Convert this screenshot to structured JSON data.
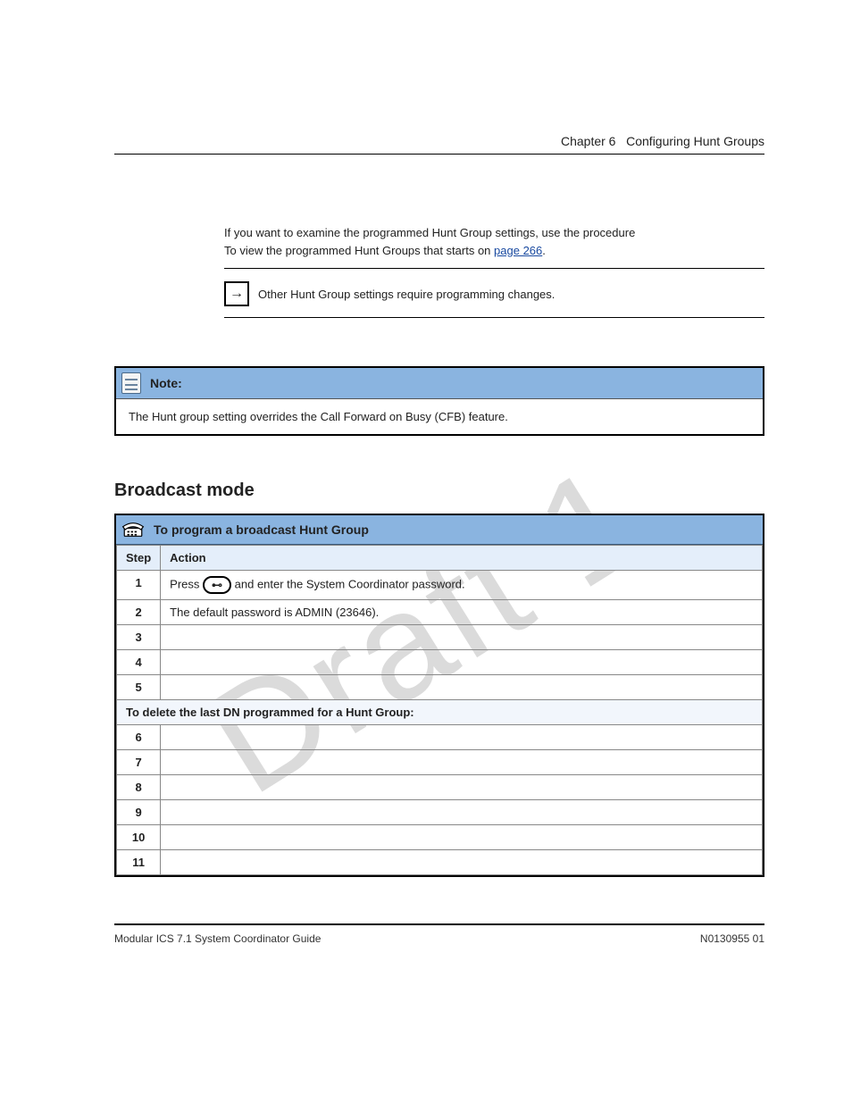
{
  "header": {
    "chapter": "Chapter 6",
    "title": "Configuring Hunt Groups"
  },
  "intro": {
    "line1": "If you want to examine the programmed Hunt Group settings, use the procedure",
    "line2_a": "To view the programmed Hunt Groups that starts on ",
    "line2_link": "page 266",
    "line2_b": "."
  },
  "arrow": {
    "text": "Other Hunt Group settings require programming changes."
  },
  "note_panel": {
    "title": "Note:",
    "body": "The Hunt group setting overrides the Call Forward on Busy (CFB) feature."
  },
  "section_heading": "Broadcast mode",
  "proc_panel": {
    "title": "To program a broadcast Hunt Group",
    "header_row": {
      "step": "Step",
      "action": "Action"
    },
    "rows": [
      {
        "step": "1",
        "prefix": "Press ",
        "key": "⊷",
        "suffix": " and enter the System Coordinator password."
      },
      {
        "step": "2",
        "text": "The default password is ADMIN (23646)."
      },
      {
        "step": "3",
        "text": ""
      },
      {
        "step": "4",
        "text": ""
      },
      {
        "step": "5",
        "text": ""
      }
    ],
    "sub_header": "To delete the last DN programmed for a Hunt Group:",
    "sub_rows": [
      {
        "step": "6",
        "text": ""
      },
      {
        "step": "7",
        "text": ""
      },
      {
        "step": "8",
        "text": ""
      },
      {
        "step": "9",
        "text": ""
      },
      {
        "step": "10",
        "text": ""
      },
      {
        "step": "11",
        "text": ""
      }
    ]
  },
  "footer": {
    "left": "Modular ICS 7.1 System Coordinator Guide",
    "right": "N0130955  01"
  },
  "watermark": "Draft 1"
}
